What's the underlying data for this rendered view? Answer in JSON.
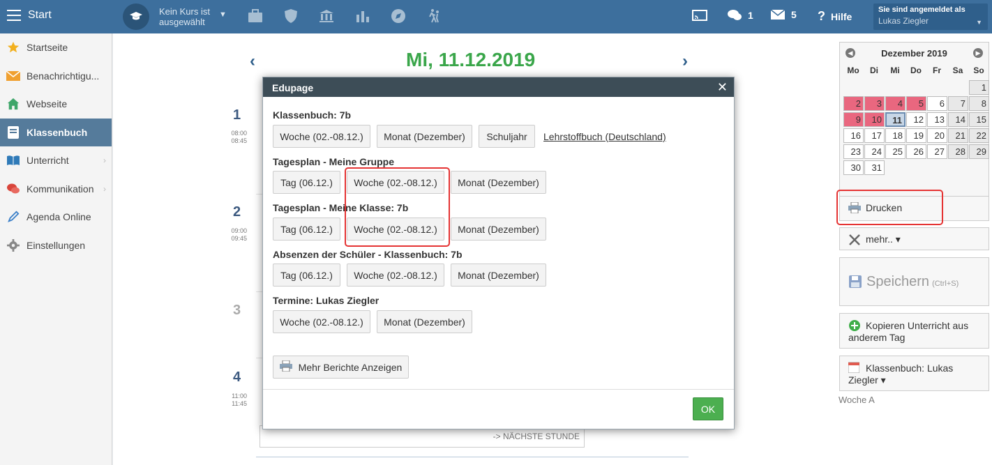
{
  "topbar": {
    "start_label": "Start",
    "course_line1": "Kein Kurs ist",
    "course_line2": "ausgewählt",
    "messages_count": "1",
    "mail_count": "5",
    "help_label": "Hilfe",
    "user_label": "Sie sind angemeldet als",
    "user_name": "Lukas Ziegler"
  },
  "sidebar": {
    "items": [
      {
        "label": "Startseite",
        "icon": "star-icon"
      },
      {
        "label": "Benachrichtigu...",
        "icon": "envelope-icon"
      },
      {
        "label": "Webseite",
        "icon": "home-icon"
      },
      {
        "label": "Klassenbuch",
        "icon": "book-icon"
      },
      {
        "label": "Unterricht",
        "icon": "open-book-icon"
      },
      {
        "label": "Kommunikation",
        "icon": "chat-icon"
      },
      {
        "label": "Agenda Online",
        "icon": "pen-icon"
      },
      {
        "label": "Einstellungen",
        "icon": "gear-icon"
      }
    ]
  },
  "main": {
    "date_title": "Mi, 11.12.2019",
    "lessons": [
      {
        "num": "1",
        "start": "08:00",
        "end": "08:45"
      },
      {
        "num": "2",
        "start": "09:00",
        "end": "09:45"
      },
      {
        "num": "3",
        "start": "",
        "end": ""
      },
      {
        "num": "4",
        "start": "11:00",
        "end": "11:45"
      }
    ],
    "next_lesson": "-> NÄCHSTE STUNDE"
  },
  "calendar": {
    "month_label": "Dezember 2019",
    "dow": [
      "Mo",
      "Di",
      "Mi",
      "Do",
      "Fr",
      "Sa",
      "So"
    ],
    "days": [
      "",
      "",
      "",
      "",
      "",
      "",
      "1",
      "2",
      "3",
      "4",
      "5",
      "6",
      "7",
      "8",
      "9",
      "10",
      "11",
      "12",
      "13",
      "14",
      "15",
      "16",
      "17",
      "18",
      "19",
      "20",
      "21",
      "22",
      "23",
      "24",
      "25",
      "26",
      "27",
      "28",
      "29",
      "30",
      "31",
      "",
      "",
      "",
      "",
      ""
    ],
    "highlighted_days": [
      "2",
      "3",
      "4",
      "5",
      "9",
      "10"
    ],
    "today": "11",
    "colors": {
      "highlight": "#e9677f",
      "today": "#c7d6e6"
    }
  },
  "right": {
    "print_label": "Drucken",
    "more_label": "mehr.. ▾",
    "save_label": "Speichern",
    "save_shortcut": "(Ctrl+S)",
    "copy_line1": "Kopieren Unterricht aus",
    "copy_line2": "anderem Tag",
    "classbook_line1": "Klassenbuch: Lukas",
    "classbook_line2": "Ziegler ▾",
    "week_label": "Woche A"
  },
  "modal": {
    "title": "Edupage",
    "sections": [
      {
        "title": "Klassenbuch: 7b",
        "buttons": [
          "Woche (02.-08.12.)",
          "Monat (Dezember)",
          "Schuljahr"
        ],
        "link": "Lehrstoffbuch (Deutschland)"
      },
      {
        "title": "Tagesplan - Meine Gruppe",
        "buttons": [
          "Tag (06.12.)",
          "Woche (02.-08.12.)",
          "Monat (Dezember)"
        ]
      },
      {
        "title": "Tagesplan - Meine Klasse: 7b",
        "buttons": [
          "Tag (06.12.)",
          "Woche (02.-08.12.)",
          "Monat (Dezember)"
        ]
      },
      {
        "title": "Absenzen der Schüler - Klassenbuch: 7b",
        "buttons": [
          "Tag (06.12.)",
          "Woche (02.-08.12.)",
          "Monat (Dezember)"
        ]
      },
      {
        "title": "Termine: Lukas Ziegler",
        "buttons": [
          "Woche (02.-08.12.)",
          "Monat (Dezember)"
        ]
      }
    ],
    "more_reports": "Mehr Berichte Anzeigen",
    "ok_label": "OK"
  }
}
